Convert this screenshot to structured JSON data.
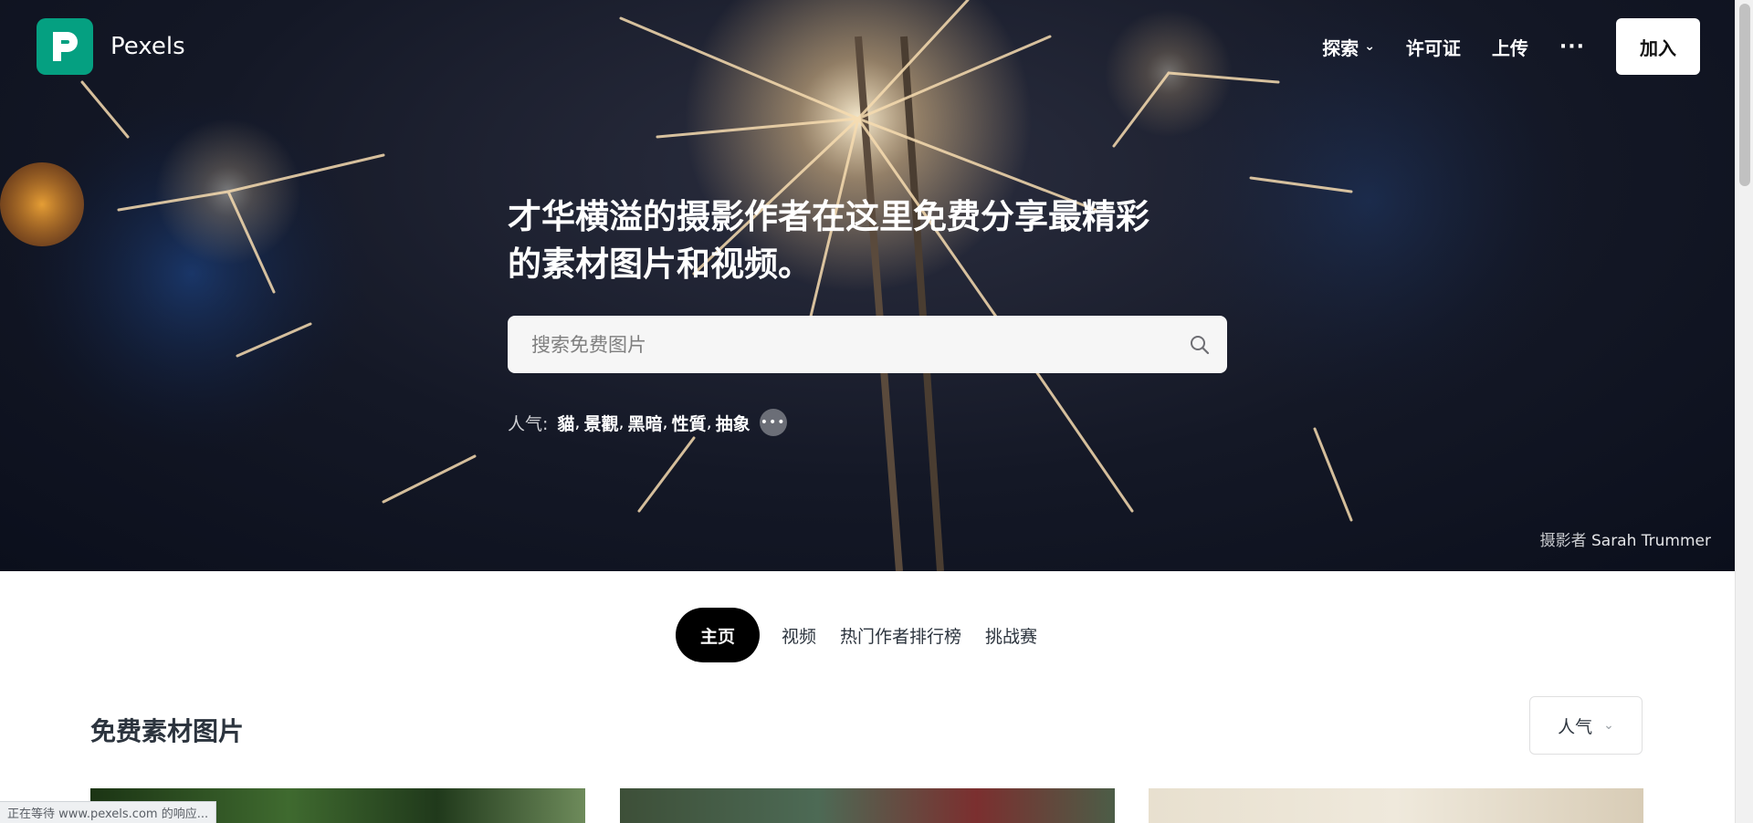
{
  "brand": {
    "name": "Pexels",
    "logo_color": "#05a081"
  },
  "nav": {
    "explore": "探索",
    "license": "许可证",
    "upload": "上传",
    "more": "···",
    "join": "加入"
  },
  "hero": {
    "title_line1": "才华横溢的摄影作者在这里免费分享最精彩",
    "title_line2": "的素材图片和视频。",
    "search_placeholder": "搜索免费图片",
    "popular_label": "人气:",
    "popular_tags": [
      "貓",
      "景觀",
      "黑暗",
      "性質",
      "抽象"
    ],
    "credit_prefix": "摄影者",
    "credit_name": "Sarah Trummer"
  },
  "tabs": [
    "主页",
    "视频",
    "热门作者排行榜",
    "挑战赛"
  ],
  "section": {
    "title": "免费素材图片",
    "sort_label": "人气"
  },
  "status_text": "正在等待 www.pexels.com 的响应..."
}
